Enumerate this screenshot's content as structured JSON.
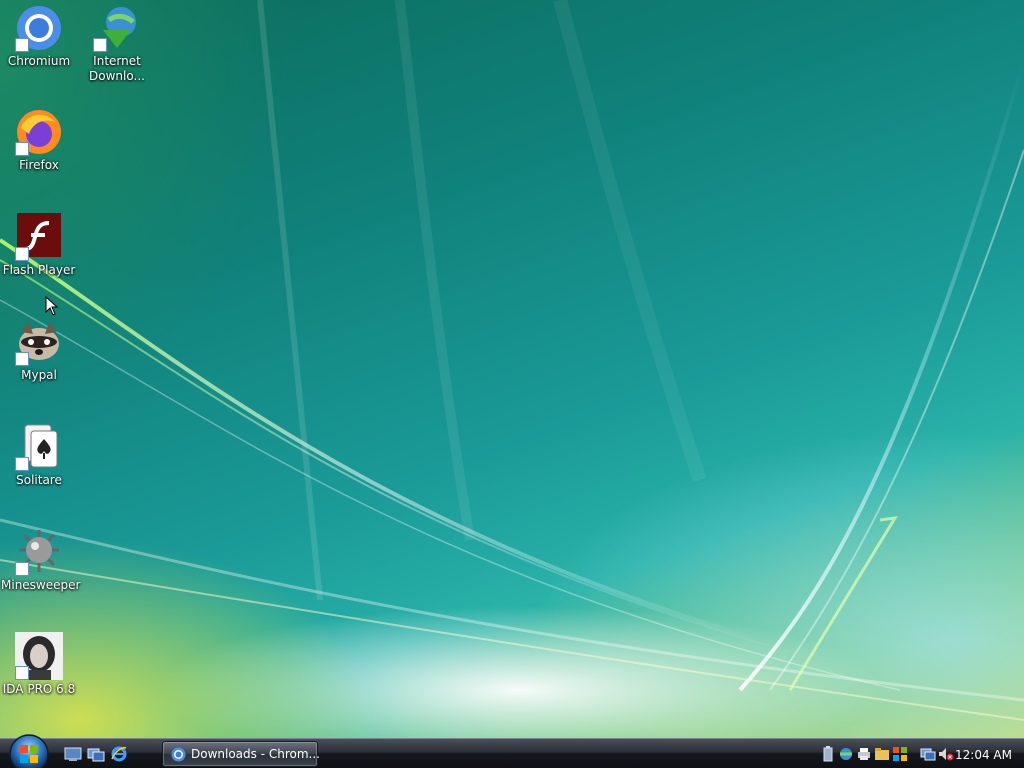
{
  "desktop": {
    "icons": [
      {
        "label": "Chromium",
        "icon": "chromium-icon"
      },
      {
        "label": "Internet Downlo...",
        "icon": "internet-download-manager-icon"
      },
      {
        "label": "Firefox",
        "icon": "firefox-icon"
      },
      {
        "label": "Flash Player",
        "icon": "flash-player-icon"
      },
      {
        "label": "Mypal",
        "icon": "mypal-raccoon-icon"
      },
      {
        "label": "Solitare",
        "icon": "solitaire-cards-icon"
      },
      {
        "label": "Minesweeper",
        "icon": "minesweeper-mine-icon"
      },
      {
        "label": "IDA PRO 6.8",
        "icon": "ida-pro-portrait-icon"
      }
    ]
  },
  "taskbar": {
    "start_icon": "windows-start-orb",
    "quick_launch": [
      "show-desktop-icon",
      "switch-windows-icon",
      "internet-explorer-icon"
    ],
    "windows": [
      {
        "label": "Downloads - Chrom...",
        "icon": "chromium-icon"
      }
    ],
    "tray_icons": [
      "battery-icon",
      "network-icon",
      "printer-icon",
      "folder-icon",
      "security-icon",
      "network-connection-icon",
      "volume-muted-icon"
    ],
    "clock": "12:04 AM"
  },
  "colors": {
    "taskbar": "#1a1d22",
    "wallpaper_teal": "#1a9a98",
    "wallpaper_yellow": "#d8dd50",
    "text": "#ffffff"
  }
}
